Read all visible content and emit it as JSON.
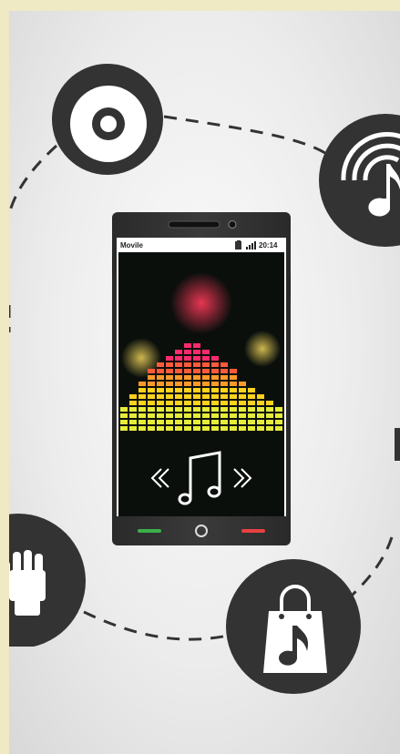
{
  "phone": {
    "carrier": "Movile",
    "time": "20:14"
  },
  "icons": {
    "cd": "cd-icon",
    "broadcast": "broadcast-music-icon",
    "hand": "pointer-hand-icon",
    "shopping": "shopping-bag-music-icon",
    "note": "music-note-icon",
    "rewind": "rewind-icon",
    "forward": "fast-forward-icon"
  },
  "colors": {
    "circle": "#333333",
    "background": "#ececec",
    "accent_red": "#e84040",
    "accent_green": "#3cb04a"
  }
}
